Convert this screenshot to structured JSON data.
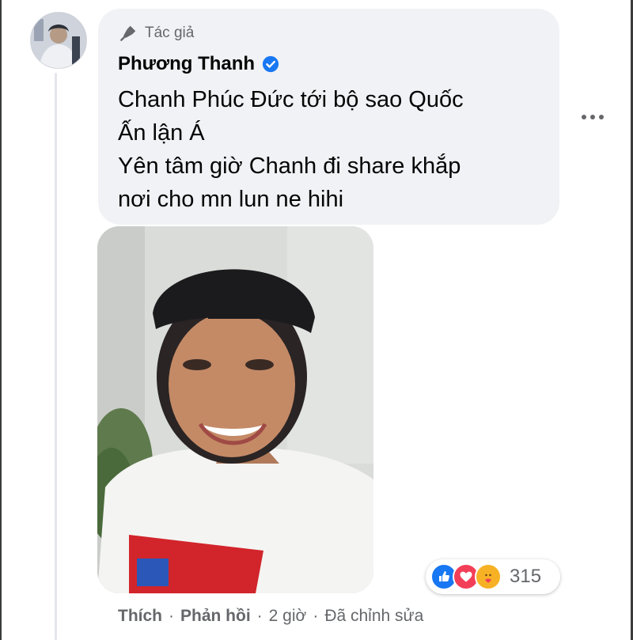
{
  "comment": {
    "badge_label": "Tác giả",
    "author_name": "Phương Thanh",
    "text_lines": [
      "Chanh Phúc Đức tới bộ sao Quốc",
      "Ấn lận Á",
      "Yên tâm giờ Chanh đi share khắp",
      "nơi cho mn lun ne hihi"
    ],
    "reaction_count": "315",
    "reactions": [
      "like-icon",
      "love-icon",
      "care-icon"
    ],
    "actions": {
      "like_label": "Thích",
      "reply_label": "Phản hồi",
      "time_label": "2 giờ",
      "edited_label": "Đã chỉnh sửa",
      "separator": "·"
    },
    "more_icon": "more-options-icon"
  },
  "colors": {
    "bubble_bg": "#f0f2f5",
    "secondary_text": "#65676b",
    "verified_blue": "#1877f2",
    "love_red": "#f33e58",
    "care_yellow": "#f7b125"
  }
}
